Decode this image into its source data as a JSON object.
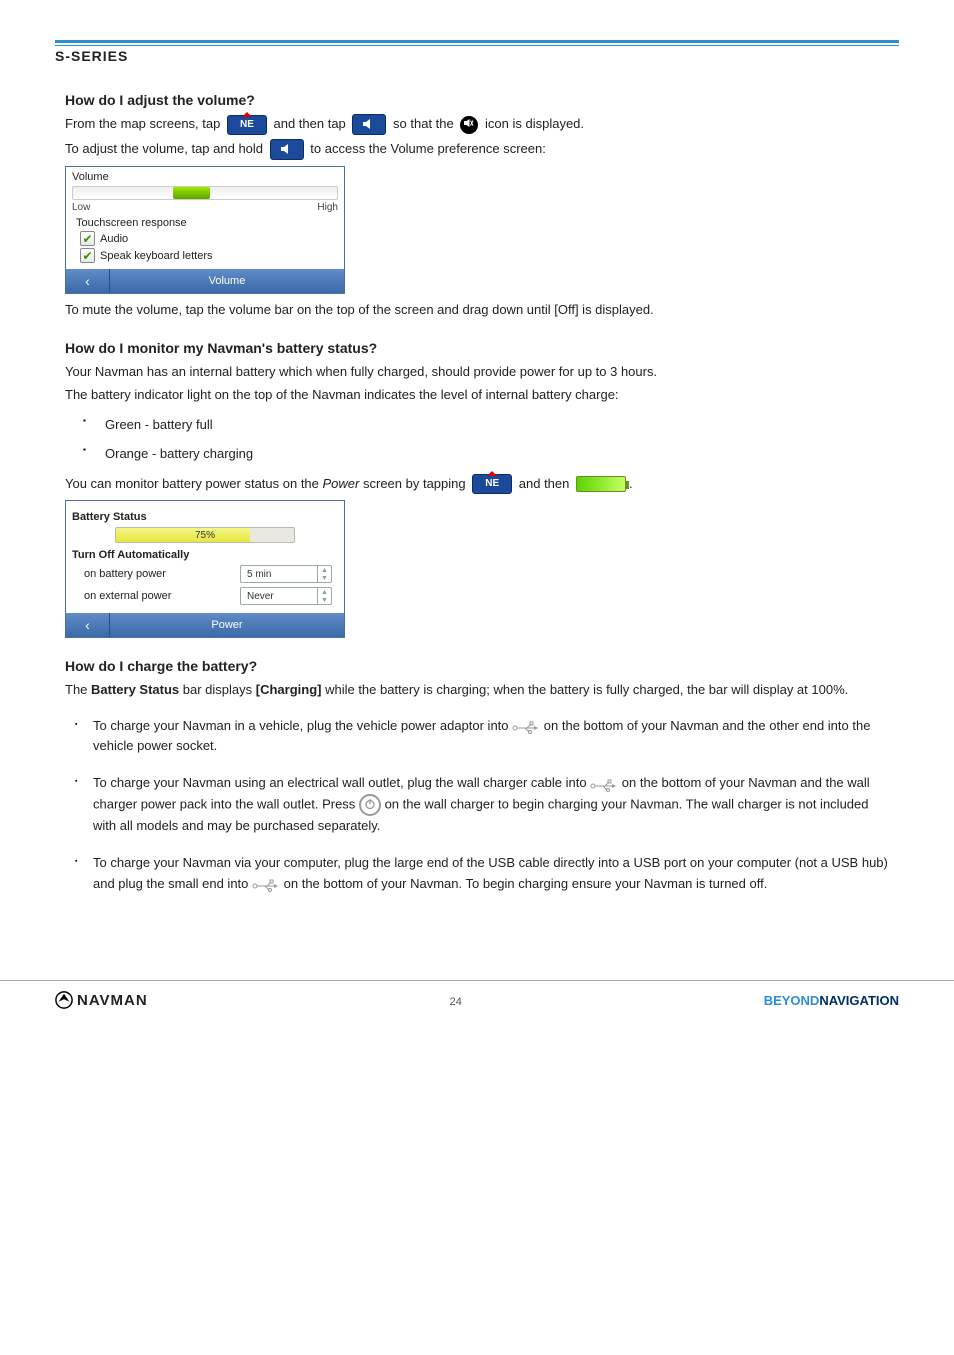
{
  "header": {
    "series": "S-SERIES"
  },
  "section_volume": {
    "heading": "How do I adjust the volume?",
    "p1_a": "From the map screens, tap",
    "p1_b": "and then tap",
    "p1_c": "so that the",
    "p1_d": "icon is displayed.",
    "p2_a": "To adjust the volume, tap and hold",
    "p2_b": "to access the Volume preference screen:",
    "screenshot": {
      "title": "Volume",
      "low": "Low",
      "high": "High",
      "touchscreen": "Touchscreen response",
      "opt_audio": "Audio",
      "opt_speak": "Speak keyboard letters",
      "footer_label": "Volume"
    },
    "p3": "To mute the volume, tap the volume bar on the top of the screen and drag down until [Off] is displayed."
  },
  "section_battery": {
    "heading": "How do I monitor my Navman's battery status?",
    "intro": "Your Navman has an internal battery which when fully charged, should provide power for up to 3 hours.",
    "bullets_intro": "The battery indicator light on the top of the Navman indicates the level of internal battery charge:",
    "bullet_green": "Green - battery full",
    "bullet_orange": "Orange - battery charging",
    "p_monitor_a": "You can monitor battery power status on the ",
    "p_monitor_b": "Power",
    "p_monitor_c": " screen by tapping",
    "p_monitor_d": "and then",
    "screenshot": {
      "title": "Battery Status",
      "percent": "75%",
      "turnoff": "Turn Off Automatically",
      "row_batt": "on battery power",
      "val_batt": "5 min",
      "row_ext": "on external power",
      "val_ext": "Never",
      "footer_label": "Power"
    }
  },
  "section_charge": {
    "heading": "How do I charge the battery?",
    "intro_a": "The ",
    "intro_b": "Battery Status",
    "intro_c": " bar displays ",
    "intro_d": "[Charging]",
    "intro_e": " while the battery is charging; when the battery is fully charged, the bar will display at 100%.",
    "step1_a": "To charge your Navman in a vehicle, plug the vehicle power adaptor into",
    "step1_b": "on the bottom of your Navman and the other end into the vehicle power socket.",
    "step2_a": "To charge your Navman using an electrical wall outlet, plug the wall charger cable into",
    "step2_b": "on the bottom of your Navman and the wall charger power pack into the wall outlet. Press",
    "step2_c": "on the wall charger to begin charging your Navman. The wall charger is not included with all models and may be purchased separately.",
    "step3_a": "To charge your Navman via your computer, plug the large end of the USB cable directly into a USB port on your computer (not a USB hub) and plug the small end into",
    "step3_b": "on the bottom of your Navman. To begin charging ensure your Navman is turned off."
  },
  "footer": {
    "brand": "NAVMAN",
    "page_no": "24",
    "tagline_a": "BEYOND",
    "tagline_b": "NAVIGATION"
  }
}
